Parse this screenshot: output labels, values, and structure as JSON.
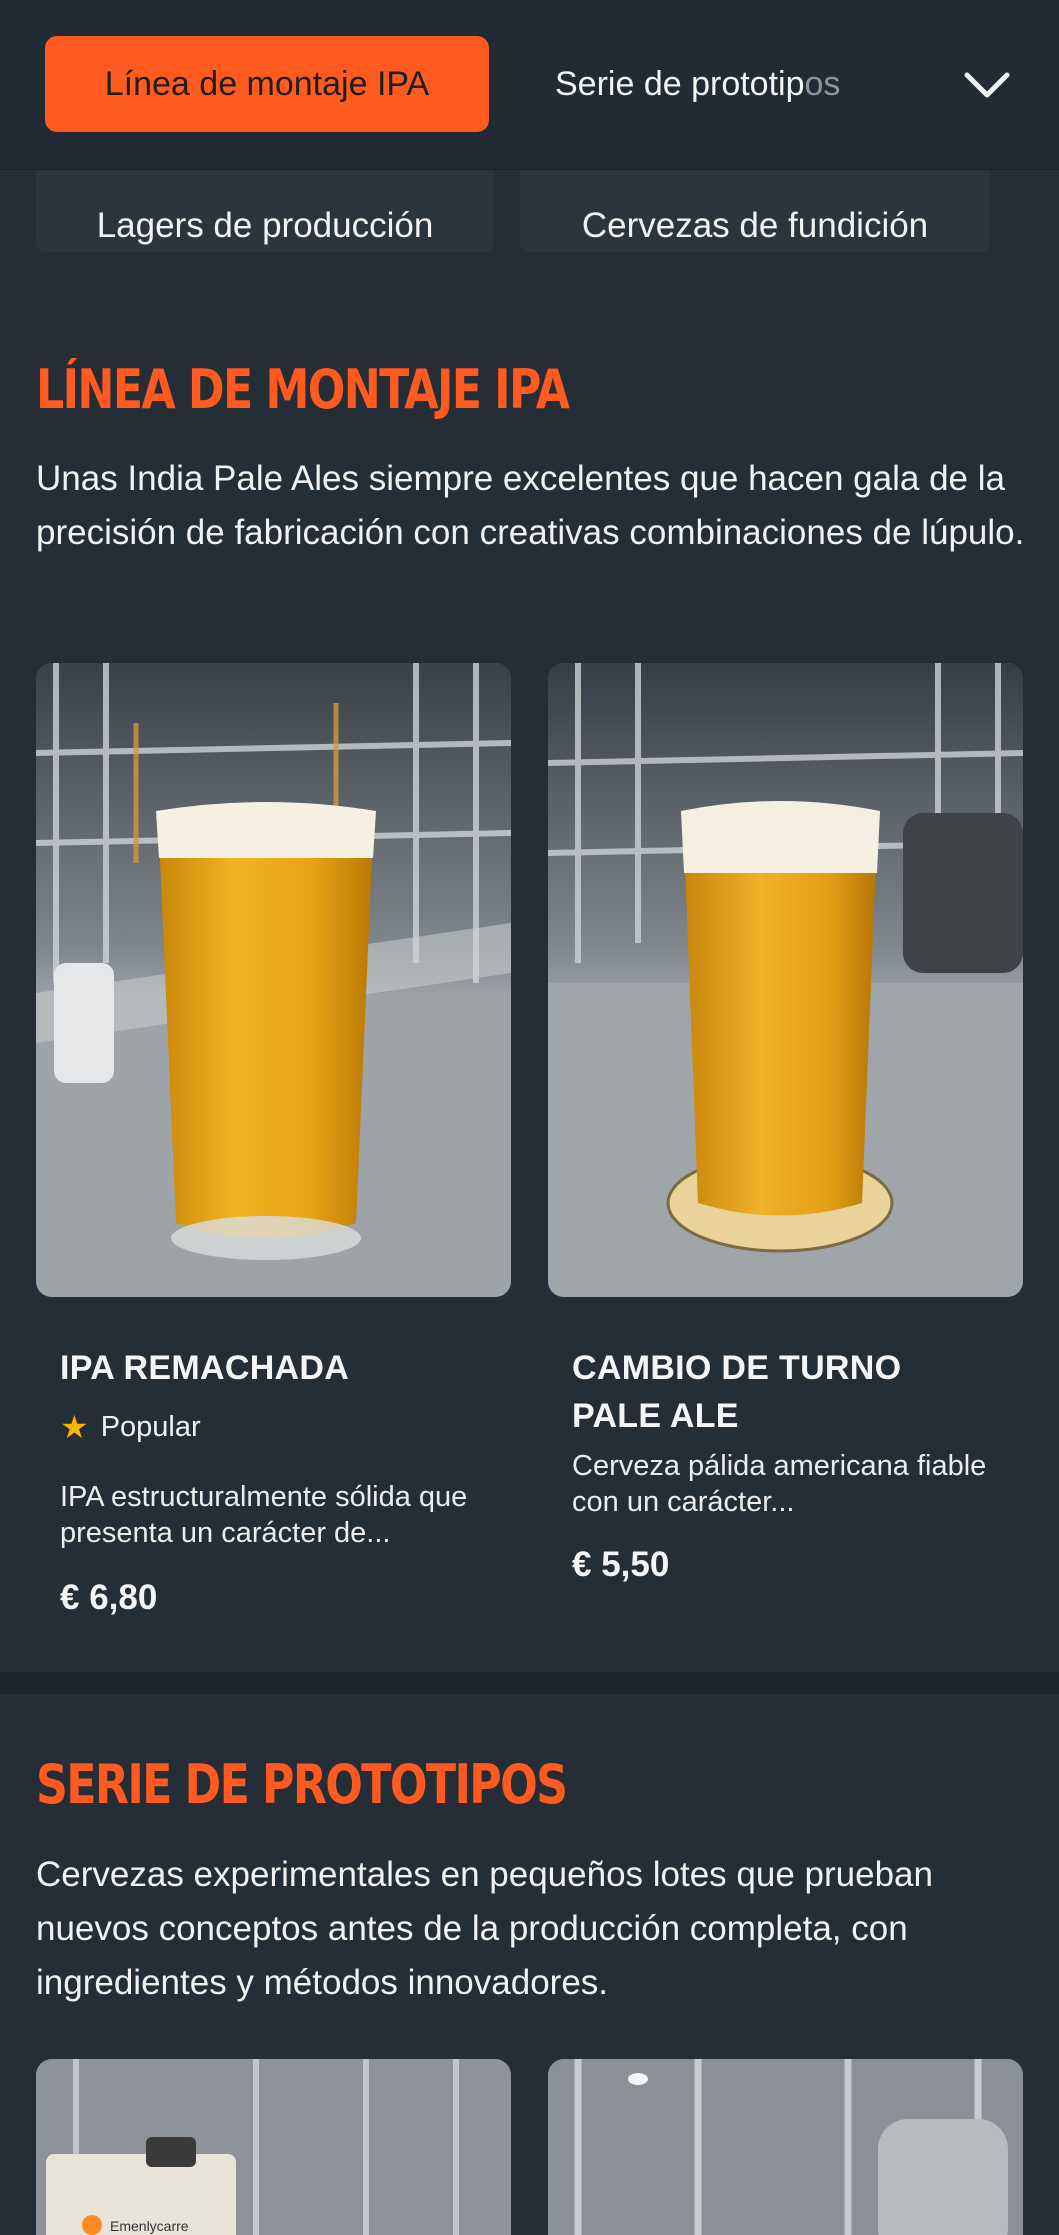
{
  "nav": {
    "active_tab": "Línea de montaje IPA",
    "next_tab": "Serie de prototip",
    "next_tab_fade": "os",
    "chips": [
      "Lagers de producción",
      "Cervezas de fundición"
    ]
  },
  "sections": [
    {
      "title": "LÍNEA DE MONTAJE IPA",
      "description": "Unas India Pale Ales siempre excelentes que hacen gala de la precisión de fabricación con creativas combinaciones de lúpulo.",
      "items": [
        {
          "name": "IPA REMACHADA",
          "badge": "Popular",
          "description": "IPA estructuralmente sólida que presenta un carácter de...",
          "price": "€ 6,80"
        },
        {
          "name": "CAMBIO DE TURNO PALE ALE",
          "description": "Cerveza pálida americana fiable con un carácter...",
          "price": "€ 5,50"
        }
      ]
    },
    {
      "title": "SERIE DE PROTOTIPOS",
      "description": "Cervezas experimentales en pequeños lotes que prueban nuevos conceptos antes de la producción completa, con ingredientes y métodos innovadores.",
      "clipboard_text": "Emenlycarre"
    }
  ],
  "colors": {
    "background": "#252e36",
    "accent": "#ff5a1f",
    "star": "#f5b400"
  },
  "icons": [
    "chevron-down-icon",
    "star-icon"
  ]
}
